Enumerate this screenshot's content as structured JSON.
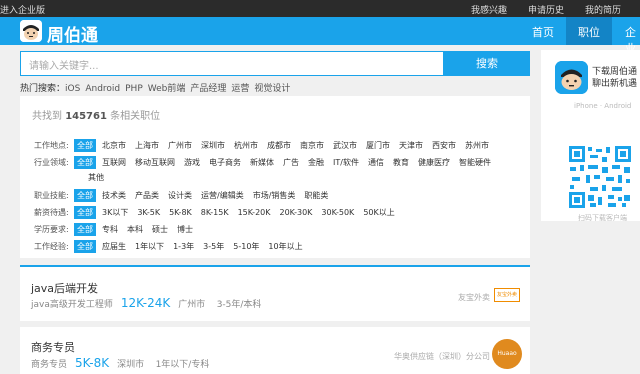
{
  "topbar": {
    "enterprise": "进入企业版",
    "links": [
      "我感兴趣",
      "申请历史",
      "我的简历"
    ]
  },
  "nav": {
    "brand": "周伯通",
    "items": [
      "首页",
      "职位",
      "企业"
    ]
  },
  "search": {
    "placeholder": "请输入关键字...",
    "button": "搜索"
  },
  "hot": {
    "label": "热门搜索：",
    "terms": [
      "iOS",
      "Android",
      "PHP",
      "Web前端",
      "产品经理",
      "运营",
      "视觉设计"
    ]
  },
  "filter": {
    "count_prefix": "共找到",
    "count": "145761",
    "count_suffix": "条相关职位",
    "rows": [
      {
        "key": "工作地点:",
        "all": "全部",
        "opts": [
          "北京市",
          "上海市",
          "广州市",
          "深圳市",
          "杭州市",
          "成都市",
          "南京市",
          "武汉市",
          "厦门市",
          "天津市",
          "西安市",
          "苏州市"
        ]
      },
      {
        "key": "行业领域:",
        "all": "全部",
        "opts": [
          "互联网",
          "移动互联网",
          "游戏",
          "电子商务",
          "新媒体",
          "广告",
          "金融",
          "IT/软件",
          "通信",
          "教育",
          "健康医疗",
          "智能硬件"
        ],
        "extra": "其他"
      },
      {
        "key": "职业技能:",
        "all": "全部",
        "opts": [
          "技术类",
          "产品类",
          "设计类",
          "运营/编辑类",
          "市场/销售类",
          "职能类"
        ]
      },
      {
        "key": "薪资待遇:",
        "all": "全部",
        "opts": [
          "3K以下",
          "3K-5K",
          "5K-8K",
          "8K-15K",
          "15K-20K",
          "20K-30K",
          "30K-50K",
          "50K以上"
        ]
      },
      {
        "key": "学历要求:",
        "all": "全部",
        "opts": [
          "专科",
          "本科",
          "硕士",
          "博士"
        ]
      },
      {
        "key": "工作经验:",
        "all": "全部",
        "opts": [
          "应届生",
          "1年以下",
          "1-3年",
          "3-5年",
          "5-10年",
          "10年以上"
        ]
      }
    ]
  },
  "jobs": [
    {
      "title": "java后端开发",
      "subtitle": "java高级开发工程师",
      "salary": "12K-24K",
      "city": "广州市",
      "req": "3-5年/本科",
      "company": "友宝外卖",
      "logo_text": "友宝外卖"
    },
    {
      "title": "商务专员",
      "subtitle": "商务专员",
      "salary": "5K-8K",
      "city": "深圳市",
      "req": "1年以下/专科",
      "company": "华奥供应链（深圳）分公司",
      "logo_text": "Huaao"
    }
  ],
  "side": {
    "download": "下载周伯通",
    "download2": "聊出新机遇",
    "platform": "iPhone · Android",
    "scan": "扫码下载客户端"
  },
  "colors": {
    "accent": "#1aa3ea",
    "topbar": "#2b2b2b"
  }
}
